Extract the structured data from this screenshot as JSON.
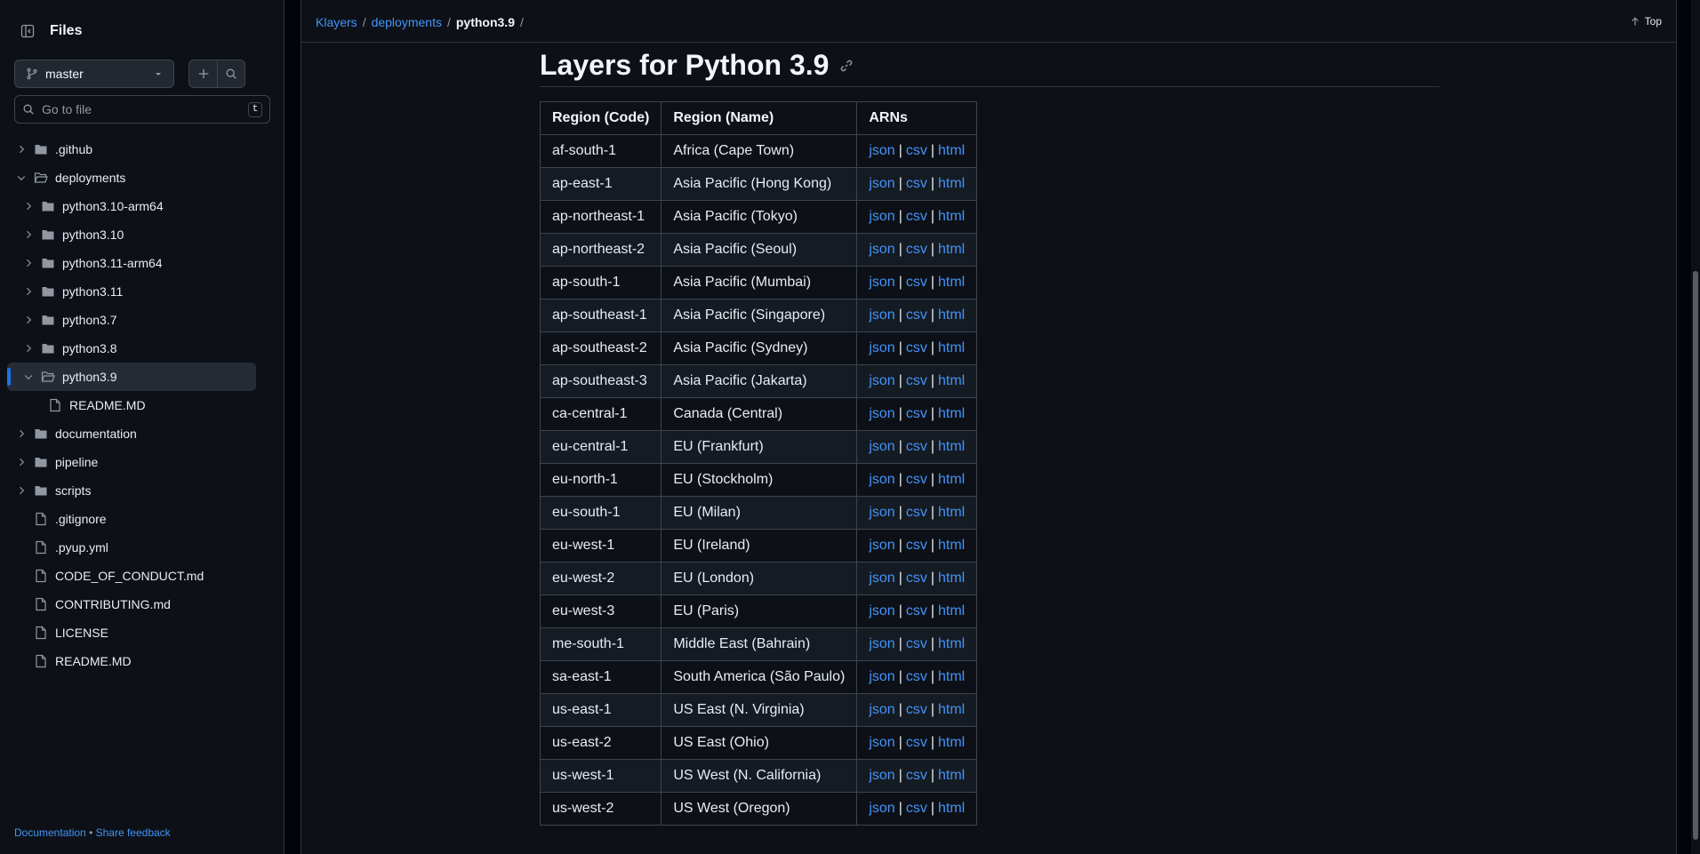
{
  "sidebar": {
    "title": "Files",
    "branch": "master",
    "search_placeholder": "Go to file",
    "search_shortcut": "t",
    "tree": [
      {
        "label": ".github",
        "type": "dir",
        "depth": 0,
        "expanded": false
      },
      {
        "label": "deployments",
        "type": "dir",
        "depth": 0,
        "expanded": true
      },
      {
        "label": "python3.10-arm64",
        "type": "dir",
        "depth": 1,
        "expanded": false
      },
      {
        "label": "python3.10",
        "type": "dir",
        "depth": 1,
        "expanded": false
      },
      {
        "label": "python3.11-arm64",
        "type": "dir",
        "depth": 1,
        "expanded": false
      },
      {
        "label": "python3.11",
        "type": "dir",
        "depth": 1,
        "expanded": false
      },
      {
        "label": "python3.7",
        "type": "dir",
        "depth": 1,
        "expanded": false
      },
      {
        "label": "python3.8",
        "type": "dir",
        "depth": 1,
        "expanded": false
      },
      {
        "label": "python3.9",
        "type": "dir",
        "depth": 1,
        "expanded": true,
        "active": true
      },
      {
        "label": "README.MD",
        "type": "file",
        "depth": 2
      },
      {
        "label": "documentation",
        "type": "dir",
        "depth": 0,
        "expanded": false
      },
      {
        "label": "pipeline",
        "type": "dir",
        "depth": 0,
        "expanded": false
      },
      {
        "label": "scripts",
        "type": "dir",
        "depth": 0,
        "expanded": false
      },
      {
        "label": ".gitignore",
        "type": "file",
        "depth": 0
      },
      {
        "label": ".pyup.yml",
        "type": "file",
        "depth": 0
      },
      {
        "label": "CODE_OF_CONDUCT.md",
        "type": "file",
        "depth": 0
      },
      {
        "label": "CONTRIBUTING.md",
        "type": "file",
        "depth": 0
      },
      {
        "label": "LICENSE",
        "type": "file",
        "depth": 0
      },
      {
        "label": "README.MD",
        "type": "file",
        "depth": 0
      }
    ],
    "footer": {
      "documentation": "Documentation",
      "separator": "•",
      "feedback": "Share feedback"
    }
  },
  "breadcrumb": {
    "items": [
      "Klayers",
      "deployments"
    ],
    "current": "python3.9",
    "separator": "/"
  },
  "top_link": "Top",
  "heading": "Layers for Python 3.9",
  "table": {
    "headers": [
      "Region (Code)",
      "Region (Name)",
      "ARNs"
    ],
    "link_labels": [
      "json",
      "csv",
      "html"
    ],
    "link_separator": "|",
    "rows": [
      {
        "code": "af-south-1",
        "name": "Africa (Cape Town)"
      },
      {
        "code": "ap-east-1",
        "name": "Asia Pacific (Hong Kong)"
      },
      {
        "code": "ap-northeast-1",
        "name": "Asia Pacific (Tokyo)"
      },
      {
        "code": "ap-northeast-2",
        "name": "Asia Pacific (Seoul)"
      },
      {
        "code": "ap-south-1",
        "name": "Asia Pacific (Mumbai)"
      },
      {
        "code": "ap-southeast-1",
        "name": "Asia Pacific (Singapore)"
      },
      {
        "code": "ap-southeast-2",
        "name": "Asia Pacific (Sydney)"
      },
      {
        "code": "ap-southeast-3",
        "name": "Asia Pacific (Jakarta)"
      },
      {
        "code": "ca-central-1",
        "name": "Canada (Central)"
      },
      {
        "code": "eu-central-1",
        "name": "EU (Frankfurt)"
      },
      {
        "code": "eu-north-1",
        "name": "EU (Stockholm)"
      },
      {
        "code": "eu-south-1",
        "name": "EU (Milan)"
      },
      {
        "code": "eu-west-1",
        "name": "EU (Ireland)"
      },
      {
        "code": "eu-west-2",
        "name": "EU (London)"
      },
      {
        "code": "eu-west-3",
        "name": "EU (Paris)"
      },
      {
        "code": "me-south-1",
        "name": "Middle East (Bahrain)"
      },
      {
        "code": "sa-east-1",
        "name": "South America (São Paulo)"
      },
      {
        "code": "us-east-1",
        "name": "US East (N. Virginia)"
      },
      {
        "code": "us-east-2",
        "name": "US East (Ohio)"
      },
      {
        "code": "us-west-1",
        "name": "US West (N. California)"
      },
      {
        "code": "us-west-2",
        "name": "US West (Oregon)"
      }
    ]
  },
  "colors": {
    "link": "#4493f8",
    "accent": "#1f6feb",
    "background": "#0d1117"
  }
}
